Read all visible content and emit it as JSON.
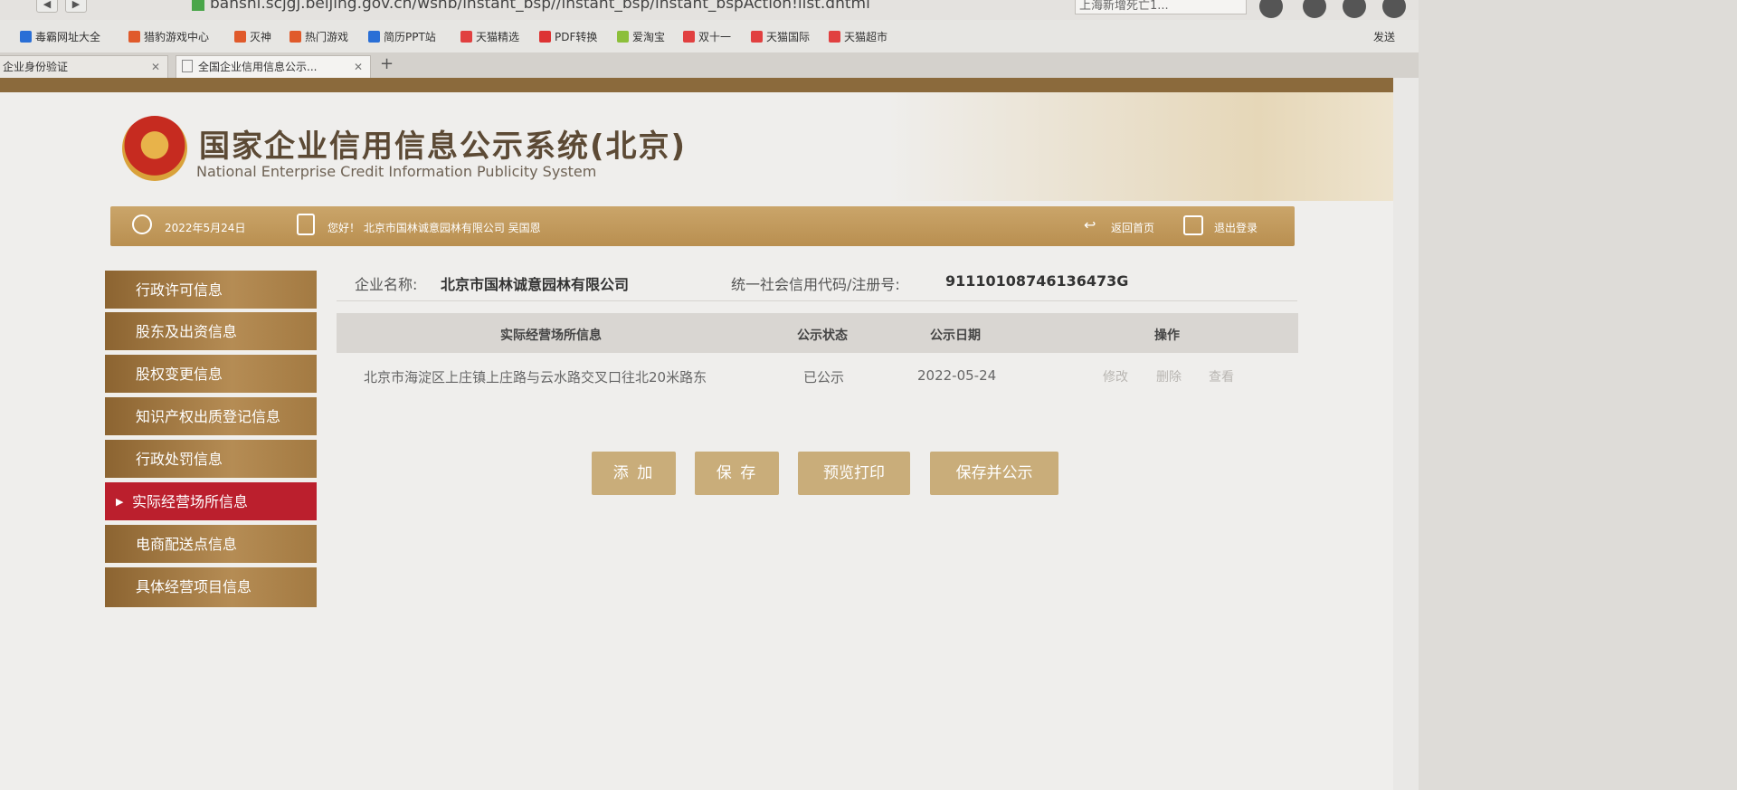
{
  "browser": {
    "url": "banshi.scjgj.beijing.gov.cn/wsnb/instant_bsp//instant_bsp/instant_bspAction!list.dhtml",
    "search_text": "上海新增死亡1...",
    "bookmarks": [
      "毒霸网址大全",
      "猎豹游戏中心",
      "灭神",
      "热门游戏",
      "简历PPT站",
      "天猫精选",
      "PDF转换",
      "爱淘宝",
      "双十一",
      "天猫国际",
      "天猫超市"
    ],
    "bookmark_right": "发送",
    "tabs": [
      {
        "label": "企业身份验证"
      },
      {
        "label": "全国企业信用信息公示..."
      }
    ],
    "new_tab": "+"
  },
  "header": {
    "title_cn": "国家企业信用信息公示系统(北京)",
    "title_en": "National Enterprise Credit Information Publicity System"
  },
  "infobar": {
    "date": "2022年5月24日",
    "greeting": "您好！ 北京市国林诚意园林有限公司  吴国恩",
    "home_link": "返回首页",
    "logout_link": "退出登录"
  },
  "sidebar": {
    "items": [
      {
        "label": "行政许可信息"
      },
      {
        "label": "股东及出资信息"
      },
      {
        "label": "股权变更信息"
      },
      {
        "label": "知识产权出质登记信息"
      },
      {
        "label": "行政处罚信息"
      },
      {
        "label": "实际经营场所信息",
        "active": true
      },
      {
        "label": "电商配送点信息"
      },
      {
        "label": "具体经营项目信息"
      }
    ]
  },
  "company": {
    "name_label": "企业名称:",
    "name": "北京市国林诚意园林有限公司",
    "code_label": "统一社会信用代码/注册号:",
    "code": "91110108746136473G"
  },
  "table": {
    "headers": [
      "实际经营场所信息",
      "公示状态",
      "公示日期",
      "操作"
    ],
    "rows": [
      {
        "address": "北京市海淀区上庄镇上庄路与云水路交叉口往北20米路东",
        "status": "已公示",
        "date": "2022-05-24",
        "actions": [
          "修改",
          "删除",
          "查看"
        ]
      }
    ]
  },
  "buttons": {
    "add": "添 加",
    "save": "保 存",
    "preview": "预览打印",
    "save_publish": "保存并公示"
  },
  "colors": {
    "brand_gold": "#b98f50",
    "active_red": "#bb1f2d",
    "button": "#c9ad7a"
  }
}
